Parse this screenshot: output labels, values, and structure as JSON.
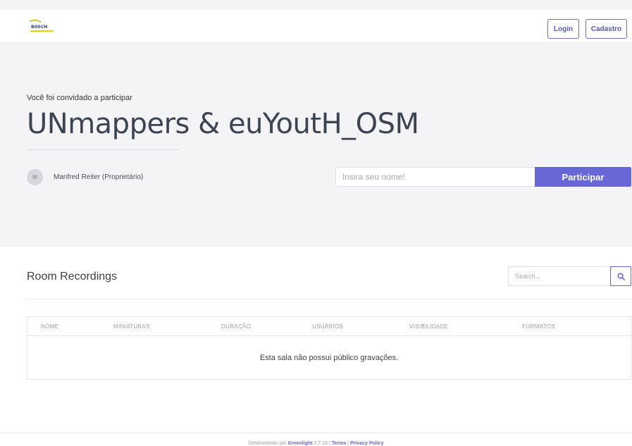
{
  "header": {
    "logo_text": "BOSCH",
    "login_label": "Login",
    "signup_label": "Cadastro"
  },
  "room": {
    "invited_text": "Você foi convidado a participar",
    "title": "UNmappers & euYoutH_OSM",
    "owner_initial": "M",
    "owner_name": "Manfred Reiter (Proprietário)",
    "name_placeholder": "Insira seu nome!",
    "join_label": "Participar"
  },
  "recordings": {
    "title": "Room Recordings",
    "search_placeholder": "Search...",
    "columns": [
      "NOME",
      "MINIATURAS",
      "DURAÇÃO",
      "USUÁRIOS",
      "VISIBILIDADE",
      "FORMATOS"
    ],
    "empty_message": "Esta sala não possui público gravações."
  },
  "footer": {
    "developed_by": "Desenvolvido por",
    "link_greenlight": "Greenlight",
    "version": "2.7.16",
    "sep1": "|",
    "link_terms": "Terms",
    "sep2": "|",
    "link_privacy": "Privacy Policy"
  },
  "colors": {
    "accent": "#6767d5",
    "hero_bg": "#f4f4f7"
  }
}
